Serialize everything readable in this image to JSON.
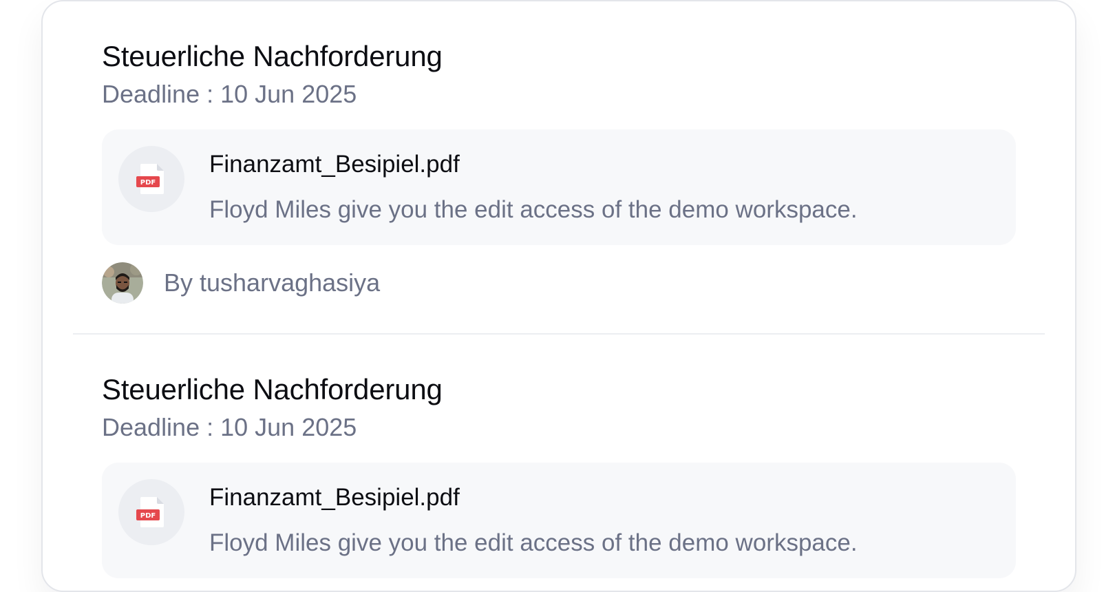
{
  "items": [
    {
      "title": "Steuerliche Nachforderung",
      "deadline": "Deadline : 10 Jun 2025",
      "file": {
        "name": "Finanzamt_Besipiel.pdf",
        "description": "Floyd Miles give you the edit access of the demo workspace.",
        "icon_label": "PDF",
        "icon": "pdf-file-icon"
      },
      "author": "By tusharvaghasiya"
    },
    {
      "title": "Steuerliche Nachforderung",
      "deadline": "Deadline : 10 Jun 2025",
      "file": {
        "name": "Finanzamt_Besipiel.pdf",
        "description": "Floyd Miles give you the edit access of the demo workspace.",
        "icon_label": "PDF",
        "icon": "pdf-file-icon"
      }
    }
  ],
  "colors": {
    "title": "#0c0d12",
    "muted": "#6b7186",
    "file_box": "#f7f8fa",
    "pdf_red": "#e5484d"
  }
}
